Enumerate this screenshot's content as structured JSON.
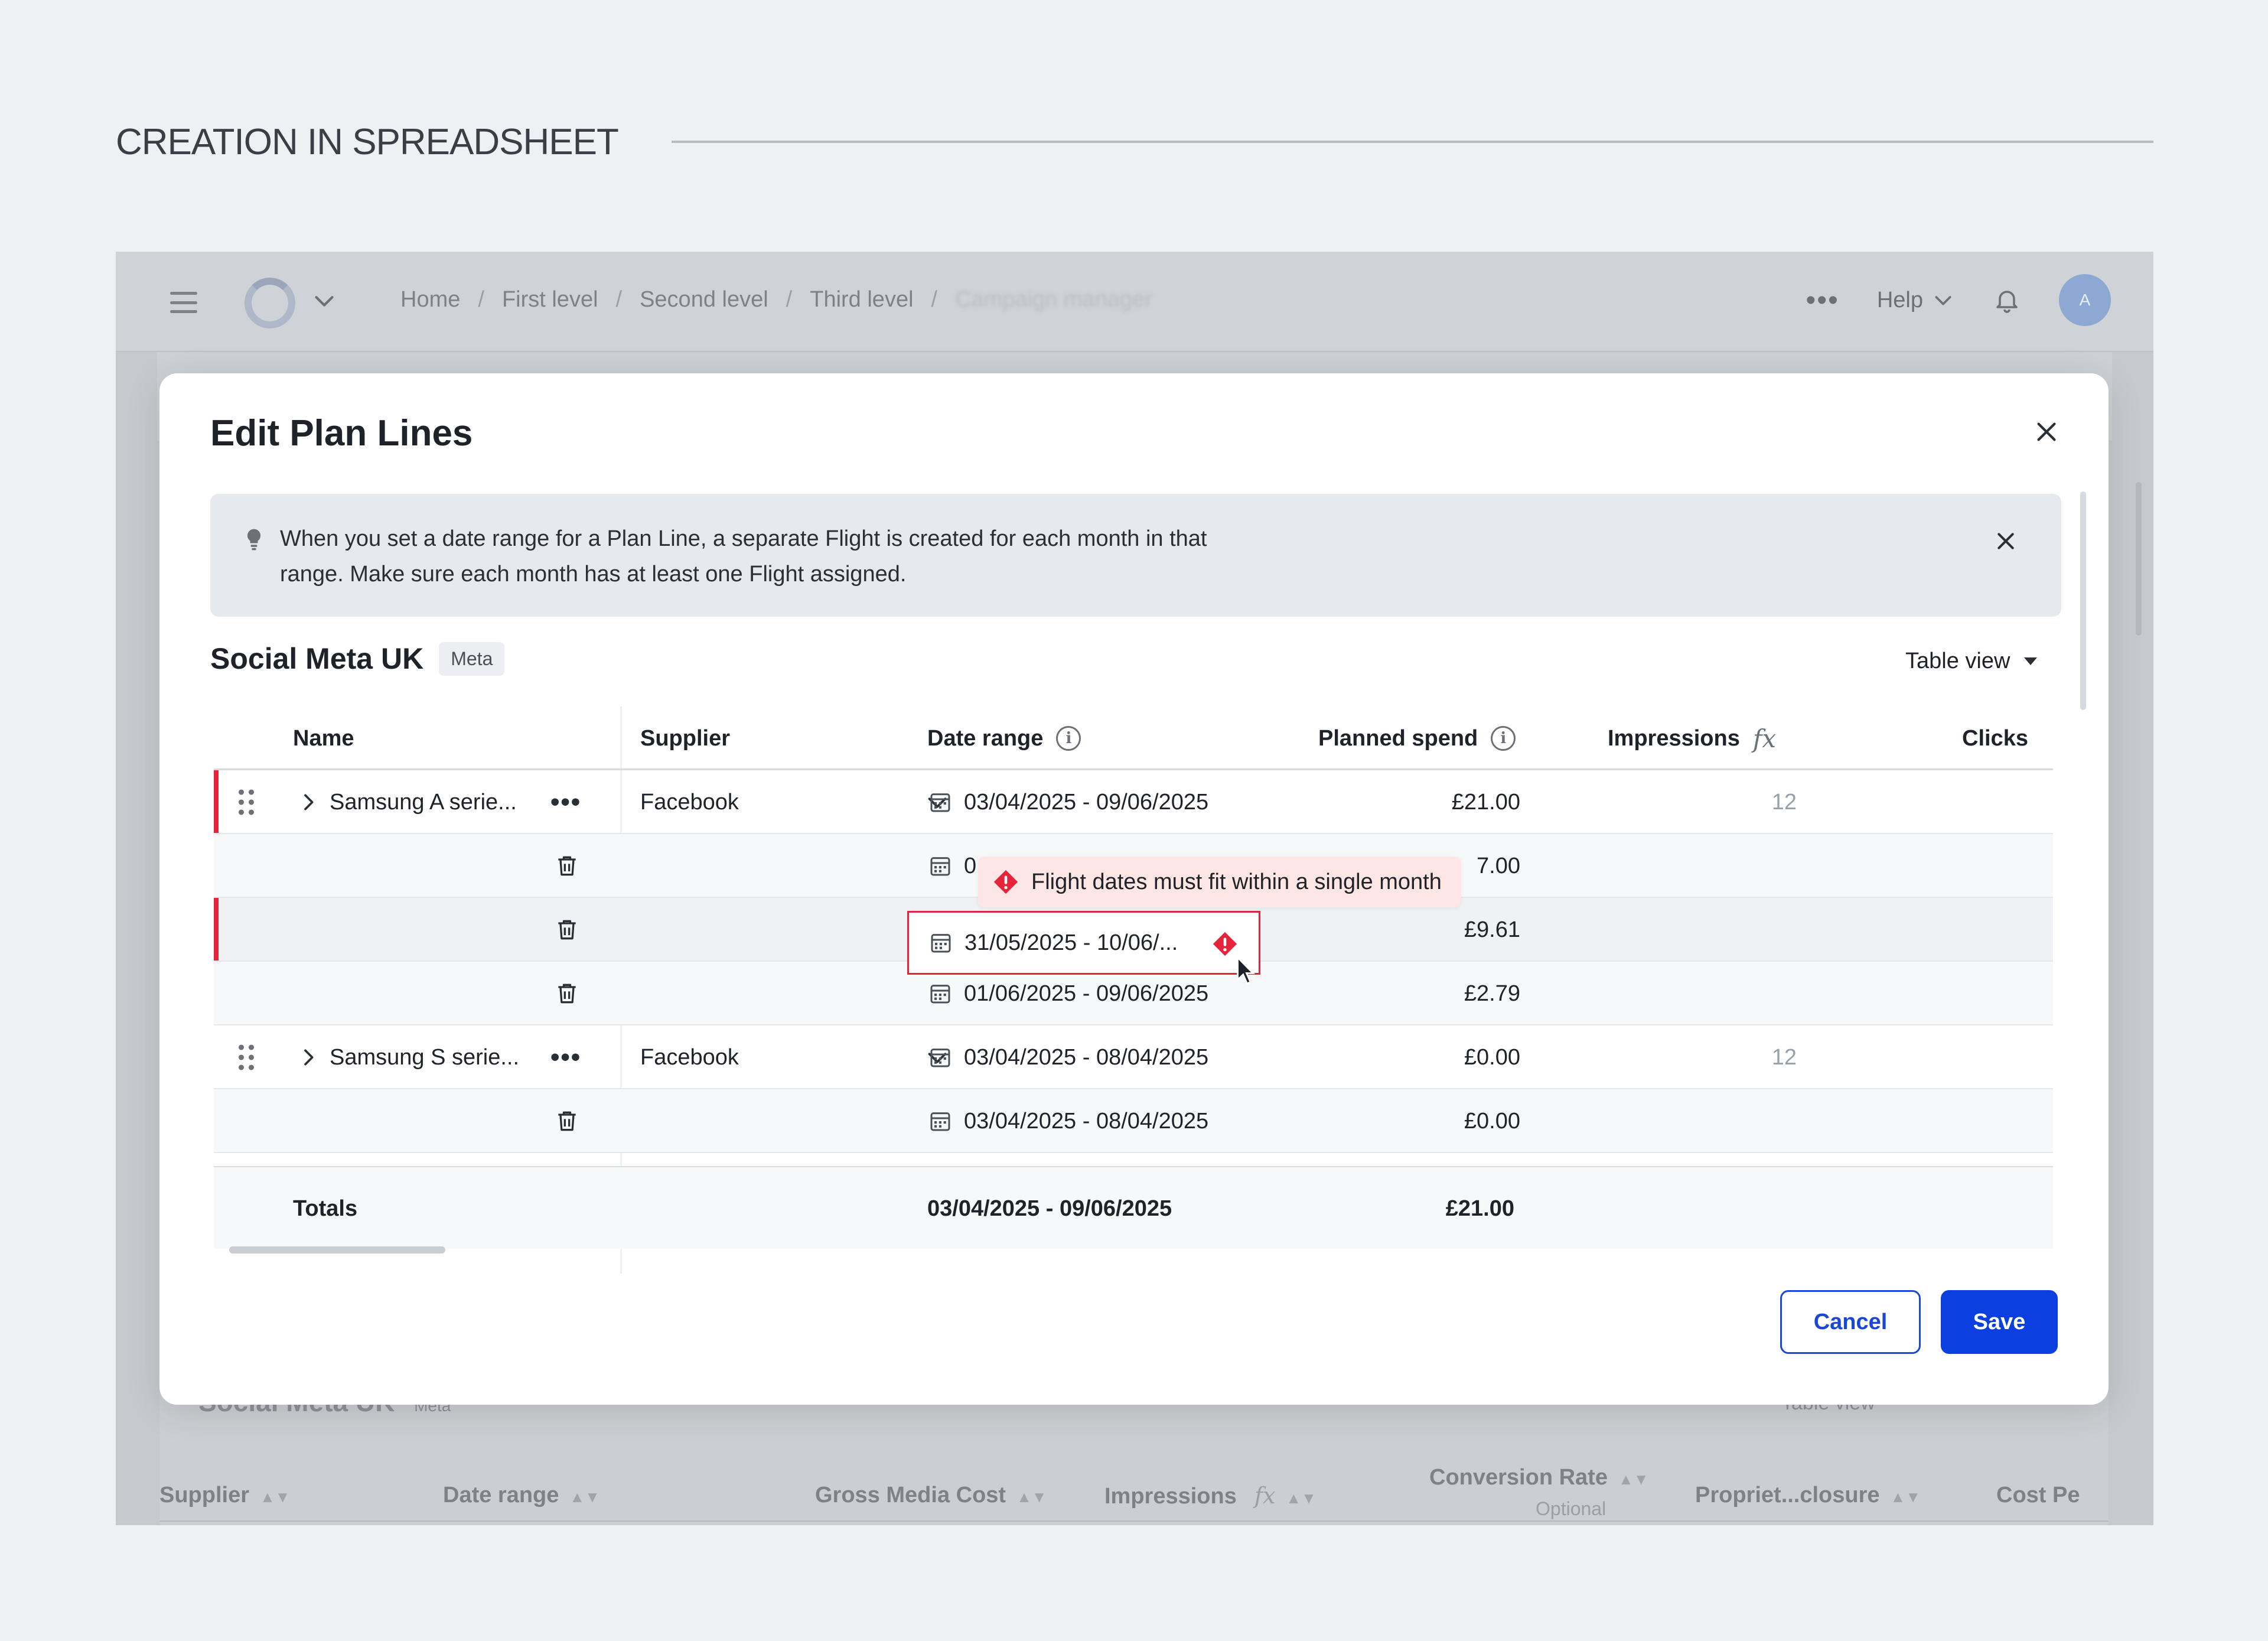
{
  "page": {
    "title": "CREATION IN SPREADSHEET"
  },
  "app": {
    "breadcrumbs": [
      "Home",
      "First level",
      "Second level",
      "Third level"
    ],
    "breadcrumb_hidden": "Campaign manager",
    "help_label": "Help",
    "avatar_initial": "A",
    "background": {
      "section_title": "Social Meta UK",
      "section_tag": "Meta",
      "table_view_label": "Table view",
      "columns": [
        {
          "label": "Supplier"
        },
        {
          "label": "Date range"
        },
        {
          "label": "Gross Media Cost"
        },
        {
          "label": "Impressions"
        },
        {
          "label": "Conversion Rate",
          "sub": "Optional"
        },
        {
          "label": "Propriet...closure"
        },
        {
          "label": "Cost Pe"
        }
      ]
    }
  },
  "modal": {
    "title": "Edit Plan Lines",
    "banner_text": "When you set a date range for a Plan Line, a separate Flight is created for each month in that range. Make sure each month has at least one Flight assigned.",
    "section_title": "Social Meta UK",
    "section_tag": "Meta",
    "table_view_label": "Table view",
    "columns": {
      "name": "Name",
      "supplier": "Supplier",
      "date_range": "Date range",
      "planned_spend": "Planned spend",
      "impressions": "Impressions",
      "clicks": "Clicks"
    },
    "rows": [
      {
        "name": "Samsung A serie...",
        "supplier": "Facebook",
        "date": "03/04/2025 - 09/06/2025",
        "spend": "£21.00",
        "impressions": "12"
      },
      {
        "date": "0",
        "spend": "7.00"
      },
      {
        "date": "31/05/2025 - 10/06/...",
        "spend": "£9.61"
      },
      {
        "date": "01/06/2025 - 09/06/2025",
        "spend": "£2.79"
      },
      {
        "name": "Samsung S serie...",
        "supplier": "Facebook",
        "date": "03/04/2025 - 08/04/2025",
        "spend": "£0.00",
        "impressions": "12"
      },
      {
        "date": "03/04/2025 - 08/04/2025",
        "spend": "£0.00"
      }
    ],
    "totals": {
      "label": "Totals",
      "date": "03/04/2025 - 09/06/2025",
      "spend": "£21.00"
    },
    "error_tooltip": "Flight dates must fit within a single month",
    "cancel_label": "Cancel",
    "save_label": "Save"
  },
  "colors": {
    "primary": "#0b3fe0",
    "error": "#e5243b",
    "tooltip_bg": "#fde6e4"
  },
  "icons": [
    "hamburger-icon",
    "chevron-down-icon",
    "more-icon",
    "bell-icon",
    "close-icon",
    "lightbulb-icon",
    "info-icon",
    "fx-icon",
    "drag-handle-icon",
    "chevron-right-icon",
    "trash-icon",
    "calendar-icon",
    "error-icon",
    "cursor-icon"
  ]
}
